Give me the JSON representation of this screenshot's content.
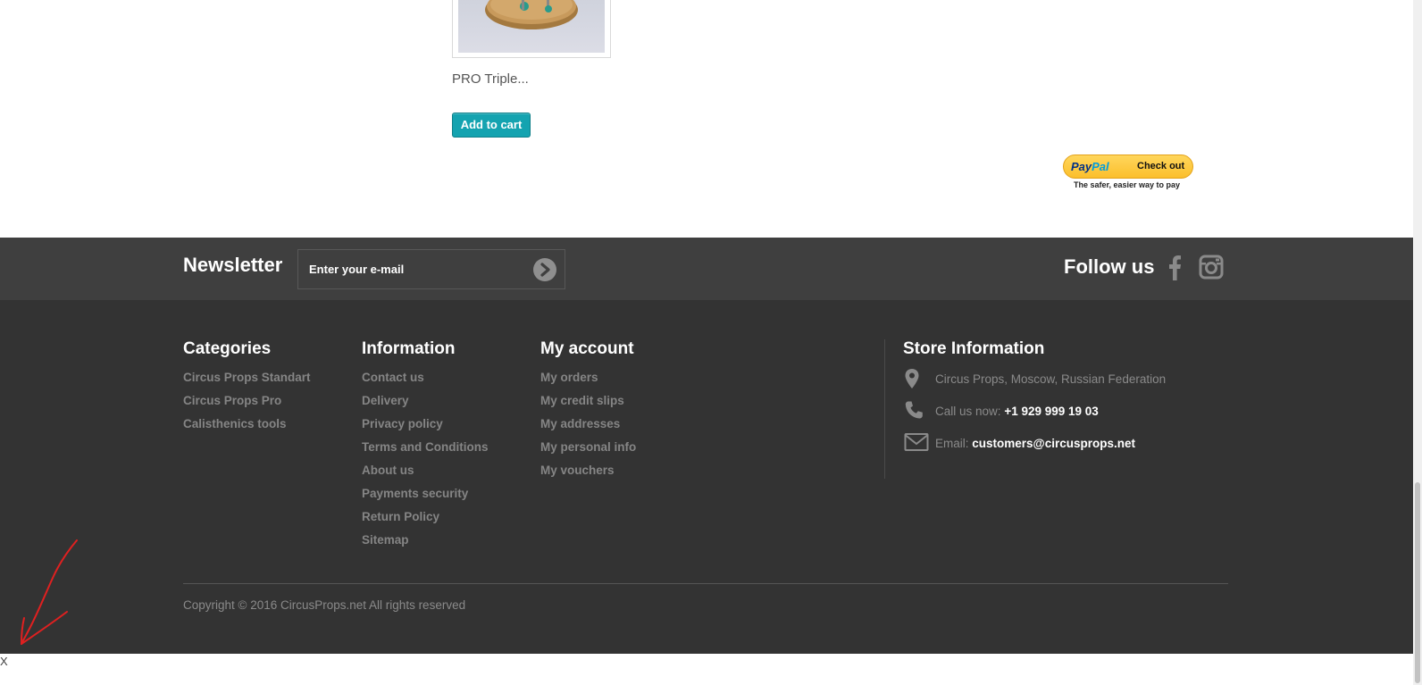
{
  "product": {
    "name": "PRO Triple...",
    "add_to_cart_label": "Add to cart"
  },
  "paypal": {
    "logo_pay": "Pay",
    "logo_pal": "Pal",
    "checkout_label": "Check out",
    "tagline": "The safer, easier way to pay"
  },
  "newsletter": {
    "title": "Newsletter",
    "input_placeholder": "Enter your e-mail",
    "submit_icon": "arrow-right-circle-icon"
  },
  "social": {
    "title": "Follow us",
    "icons": [
      "facebook-icon",
      "instagram-icon"
    ]
  },
  "footer": {
    "categories": {
      "title": "Categories",
      "items": [
        "Circus Props Standart",
        "Circus Props Pro",
        "Calisthenics tools"
      ]
    },
    "information": {
      "title": "Information",
      "items": [
        "Contact us",
        "Delivery",
        "Privacy policy",
        "Terms and Conditions",
        "About us",
        "Payments security",
        "Return Policy",
        "Sitemap"
      ]
    },
    "account": {
      "title": "My account",
      "items": [
        "My orders",
        "My credit slips",
        "My addresses",
        "My personal info",
        "My vouchers"
      ]
    },
    "store": {
      "title": "Store Information",
      "address": "Circus Props, Moscow, Russian Federation",
      "phone_label": "Call us now:",
      "phone": "+1 929 999 19 03",
      "email_label": "Email:",
      "email": "customers@circusprops.net"
    },
    "copyright": "Copyright © 2016 CircusProps.net All rights reserved"
  },
  "bottom": {
    "close_label": "X"
  },
  "colors": {
    "accent_teal": "#14a3b0",
    "newsletter_bg": "#3f3f3f",
    "footer_bg": "#333333",
    "annotation_red": "#e02020"
  }
}
